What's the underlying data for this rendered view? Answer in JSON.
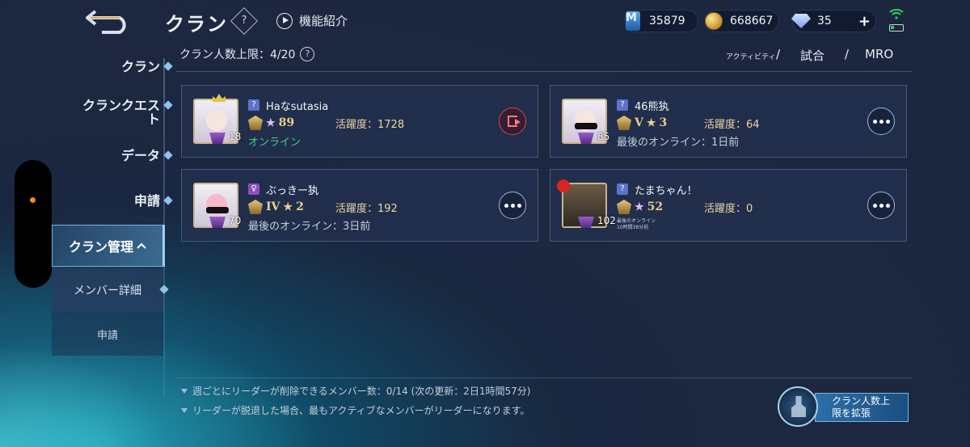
{
  "header": {
    "title": "クラン",
    "help_mark": "?",
    "feature_label": "機能紹介"
  },
  "currencies": {
    "m_points": "35879",
    "gold": "668667",
    "gems": "35",
    "plus": "+"
  },
  "sidebar": {
    "items": [
      {
        "label": "クラン"
      },
      {
        "label": "クランクエスト"
      },
      {
        "label": "データ"
      },
      {
        "label": "申請"
      },
      {
        "label": "クラン管理"
      }
    ],
    "sub_items": [
      {
        "label": "メンバー詳細"
      },
      {
        "label": "申請"
      }
    ]
  },
  "content": {
    "limit_label": "クラン人数上限：4/20",
    "sort": {
      "activity": "アクティビティ",
      "sep": "/",
      "match": "試合",
      "mro": "MRO"
    }
  },
  "members": [
    {
      "name": "Haなsutasia",
      "level": "18",
      "rank_tier": "",
      "stars": "89",
      "activity": "活躍度：1728",
      "status": "オンライン"
    },
    {
      "name": "46熊犱",
      "level": "85",
      "rank_tier": "V",
      "stars": "3",
      "activity": "活躍度：64",
      "status": "最後のオンライン：1日前"
    },
    {
      "name": "ぶっきー犱",
      "level": "70",
      "rank_tier": "IV",
      "stars": "2",
      "activity": "活躍度：192",
      "status": "最後のオンライン：3日前"
    },
    {
      "name": "たまちゃん！",
      "level": "102",
      "rank_tier": "",
      "stars": "52",
      "activity": "活躍度：0",
      "status_line1": "最後のオンライン",
      "status_line2": "10時間38分前"
    }
  ],
  "notes": {
    "line1": "週ごとにリーダーが削除できるメンバー数：0/14 (次の更新：2日1時間57分)",
    "line2": "リーダーが脱退した場合、最もアクティブなメンバーがリーダーになります。"
  },
  "expand": {
    "line1": "クラン人数上",
    "line2": "限を拡張"
  },
  "colors": {
    "online": "#42d07d",
    "activity_gold": "#e9d7a4",
    "exit_red": "#d04a52",
    "accent_blue": "#7ab0d8"
  },
  "icons": {
    "back": "back-arrow-icon",
    "play": "play-circle-icon",
    "more": "more-dots-icon",
    "exit": "exit-door-icon"
  }
}
